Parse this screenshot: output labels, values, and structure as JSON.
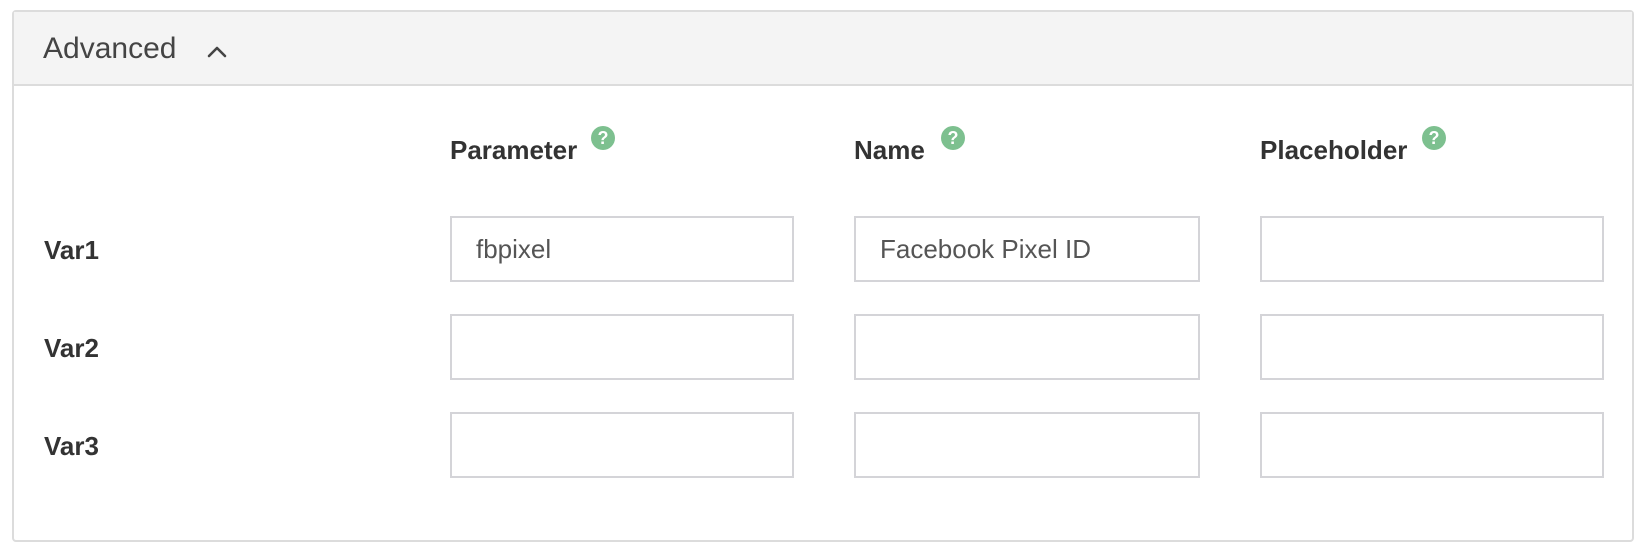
{
  "section": {
    "title": "Advanced",
    "expanded": true,
    "toggle_icon": "chevron-up-icon"
  },
  "columns": [
    {
      "label": "Parameter",
      "help_icon": "question-icon",
      "help_glyph": "?"
    },
    {
      "label": "Name",
      "help_icon": "question-icon",
      "help_glyph": "?"
    },
    {
      "label": "Placeholder",
      "help_icon": "question-icon",
      "help_glyph": "?"
    }
  ],
  "rows": [
    {
      "label": "Var1",
      "parameter": "fbpixel",
      "name": "Facebook Pixel ID",
      "placeholder": ""
    },
    {
      "label": "Var2",
      "parameter": "",
      "name": "",
      "placeholder": ""
    },
    {
      "label": "Var3",
      "parameter": "",
      "name": "",
      "placeholder": ""
    }
  ],
  "colors": {
    "help_icon": "#7dc08f",
    "header_bg": "#f4f4f4",
    "border": "#dcdcdc"
  }
}
